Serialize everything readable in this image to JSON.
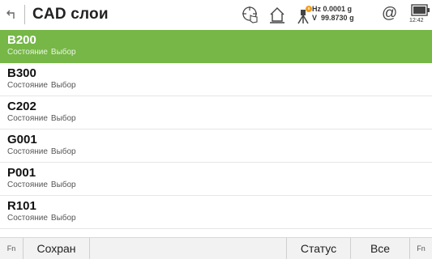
{
  "header": {
    "title": "CAD слои",
    "icons": [
      "back-arrow-icon",
      "crosshair-hand-icon",
      "home-icon",
      "tripod-icon",
      "at-icon",
      "battery-icon"
    ],
    "hz_label": "Hz",
    "hz_value": "0.0001 g",
    "v_label": "V",
    "v_value": "99.8730 g",
    "at_symbol": "@",
    "battery_time": "12:42"
  },
  "layers": [
    {
      "code": "B200",
      "state": "Состояние",
      "select": "Выбор",
      "selected": true
    },
    {
      "code": "B300",
      "state": "Состояние",
      "select": "Выбор",
      "selected": false
    },
    {
      "code": "C202",
      "state": "Состояние",
      "select": "Выбор",
      "selected": false
    },
    {
      "code": "G001",
      "state": "Состояние",
      "select": "Выбор",
      "selected": false
    },
    {
      "code": "P001",
      "state": "Состояние",
      "select": "Выбор",
      "selected": false
    },
    {
      "code": "R101",
      "state": "Состояние",
      "select": "Выбор",
      "selected": false
    }
  ],
  "footer": {
    "fn_left": "Fn",
    "save_label": "Сохран",
    "status_label": "Статус",
    "all_label": "Все",
    "fn_right": "Fn"
  },
  "colors": {
    "selected_row": "#76b747",
    "badge": "#f0a020"
  }
}
